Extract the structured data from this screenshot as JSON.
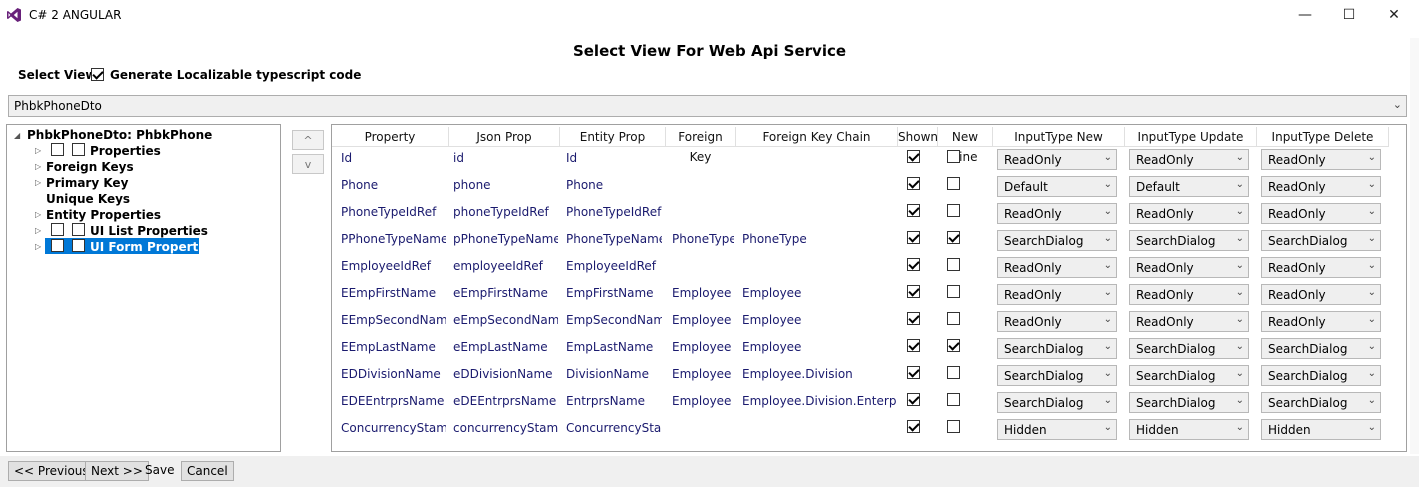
{
  "window": {
    "title": "C# 2 ANGULAR",
    "minimize": "—",
    "maximize": "☐",
    "close": "✕"
  },
  "heading": "Select View For Web Api Service",
  "select_view_label": "Select View.",
  "generate_localizable": {
    "label": "Generate Localizable typescript code",
    "checked": true
  },
  "view_combo": {
    "value": "PhbkPhoneDto"
  },
  "tree": {
    "root": "PhbkPhoneDto: PhbkPhone",
    "items": [
      {
        "label": "Properties"
      },
      {
        "label": "Foreign Keys"
      },
      {
        "label": "Primary Key"
      },
      {
        "label": "Unique Keys"
      },
      {
        "label": "Entity Properties"
      },
      {
        "label": "UI List Properties"
      },
      {
        "label": "UI Form Properties"
      }
    ]
  },
  "move_buttons": {
    "up": "^",
    "down": "v"
  },
  "grid": {
    "headers": [
      "Property",
      "Json Prop",
      "Entity Prop",
      "Foreign Key",
      "Foreign Key Chain",
      "Shown",
      "New Line",
      "InputType New",
      "InputType Update",
      "InputType Delete"
    ],
    "rows": [
      {
        "property": "Id",
        "json": "id",
        "entity": "Id",
        "fk": "",
        "fkchain": "",
        "shown": true,
        "newline": false,
        "new": "ReadOnly",
        "update": "ReadOnly",
        "delete": "ReadOnly"
      },
      {
        "property": "Phone",
        "json": "phone",
        "entity": "Phone",
        "fk": "",
        "fkchain": "",
        "shown": true,
        "newline": false,
        "new": "Default",
        "update": "Default",
        "delete": "ReadOnly"
      },
      {
        "property": "PhoneTypeIdRef",
        "json": "phoneTypeIdRef",
        "entity": "PhoneTypeIdRef",
        "fk": "",
        "fkchain": "",
        "shown": true,
        "newline": false,
        "new": "ReadOnly",
        "update": "ReadOnly",
        "delete": "ReadOnly"
      },
      {
        "property": "PPhoneTypeName",
        "json": "pPhoneTypeName",
        "entity": "PhoneTypeName",
        "fk": "PhoneType",
        "fkchain": "PhoneType",
        "shown": true,
        "newline": true,
        "new": "SearchDialog",
        "update": "SearchDialog",
        "delete": "SearchDialog"
      },
      {
        "property": "EmployeeIdRef",
        "json": "employeeIdRef",
        "entity": "EmployeeIdRef",
        "fk": "",
        "fkchain": "",
        "shown": true,
        "newline": false,
        "new": "ReadOnly",
        "update": "ReadOnly",
        "delete": "ReadOnly"
      },
      {
        "property": "EEmpFirstName",
        "json": "eEmpFirstName",
        "entity": "EmpFirstName",
        "fk": "Employee",
        "fkchain": "Employee",
        "shown": true,
        "newline": false,
        "new": "ReadOnly",
        "update": "ReadOnly",
        "delete": "ReadOnly"
      },
      {
        "property": "EEmpSecondName",
        "json": "eEmpSecondName",
        "entity": "EmpSecondName",
        "fk": "Employee",
        "fkchain": "Employee",
        "shown": true,
        "newline": false,
        "new": "ReadOnly",
        "update": "ReadOnly",
        "delete": "ReadOnly"
      },
      {
        "property": "EEmpLastName",
        "json": "eEmpLastName",
        "entity": "EmpLastName",
        "fk": "Employee",
        "fkchain": "Employee",
        "shown": true,
        "newline": true,
        "new": "SearchDialog",
        "update": "SearchDialog",
        "delete": "SearchDialog"
      },
      {
        "property": "EDDivisionName",
        "json": "eDDivisionName",
        "entity": "DivisionName",
        "fk": "Employee",
        "fkchain": "Employee.Division",
        "shown": true,
        "newline": false,
        "new": "SearchDialog",
        "update": "SearchDialog",
        "delete": "SearchDialog"
      },
      {
        "property": "EDEEntrprsName",
        "json": "eDEEntrprsName",
        "entity": "EntrprsName",
        "fk": "Employee",
        "fkchain": "Employee.Division.Enterprise",
        "shown": true,
        "newline": false,
        "new": "SearchDialog",
        "update": "SearchDialog",
        "delete": "SearchDialog"
      },
      {
        "property": "ConcurrencyStamp",
        "json": "concurrencyStamp",
        "entity": "ConcurrencyStamp",
        "fk": "",
        "fkchain": "",
        "shown": true,
        "newline": false,
        "new": "Hidden",
        "update": "Hidden",
        "delete": "Hidden"
      }
    ]
  },
  "footer": {
    "previous": "<< Previous",
    "next": "Next >>",
    "save": "Save",
    "cancel": "Cancel"
  },
  "colors": {
    "selection": "#0078d7",
    "text_link": "#1a1a6e",
    "vs_purple": "#68217a"
  }
}
